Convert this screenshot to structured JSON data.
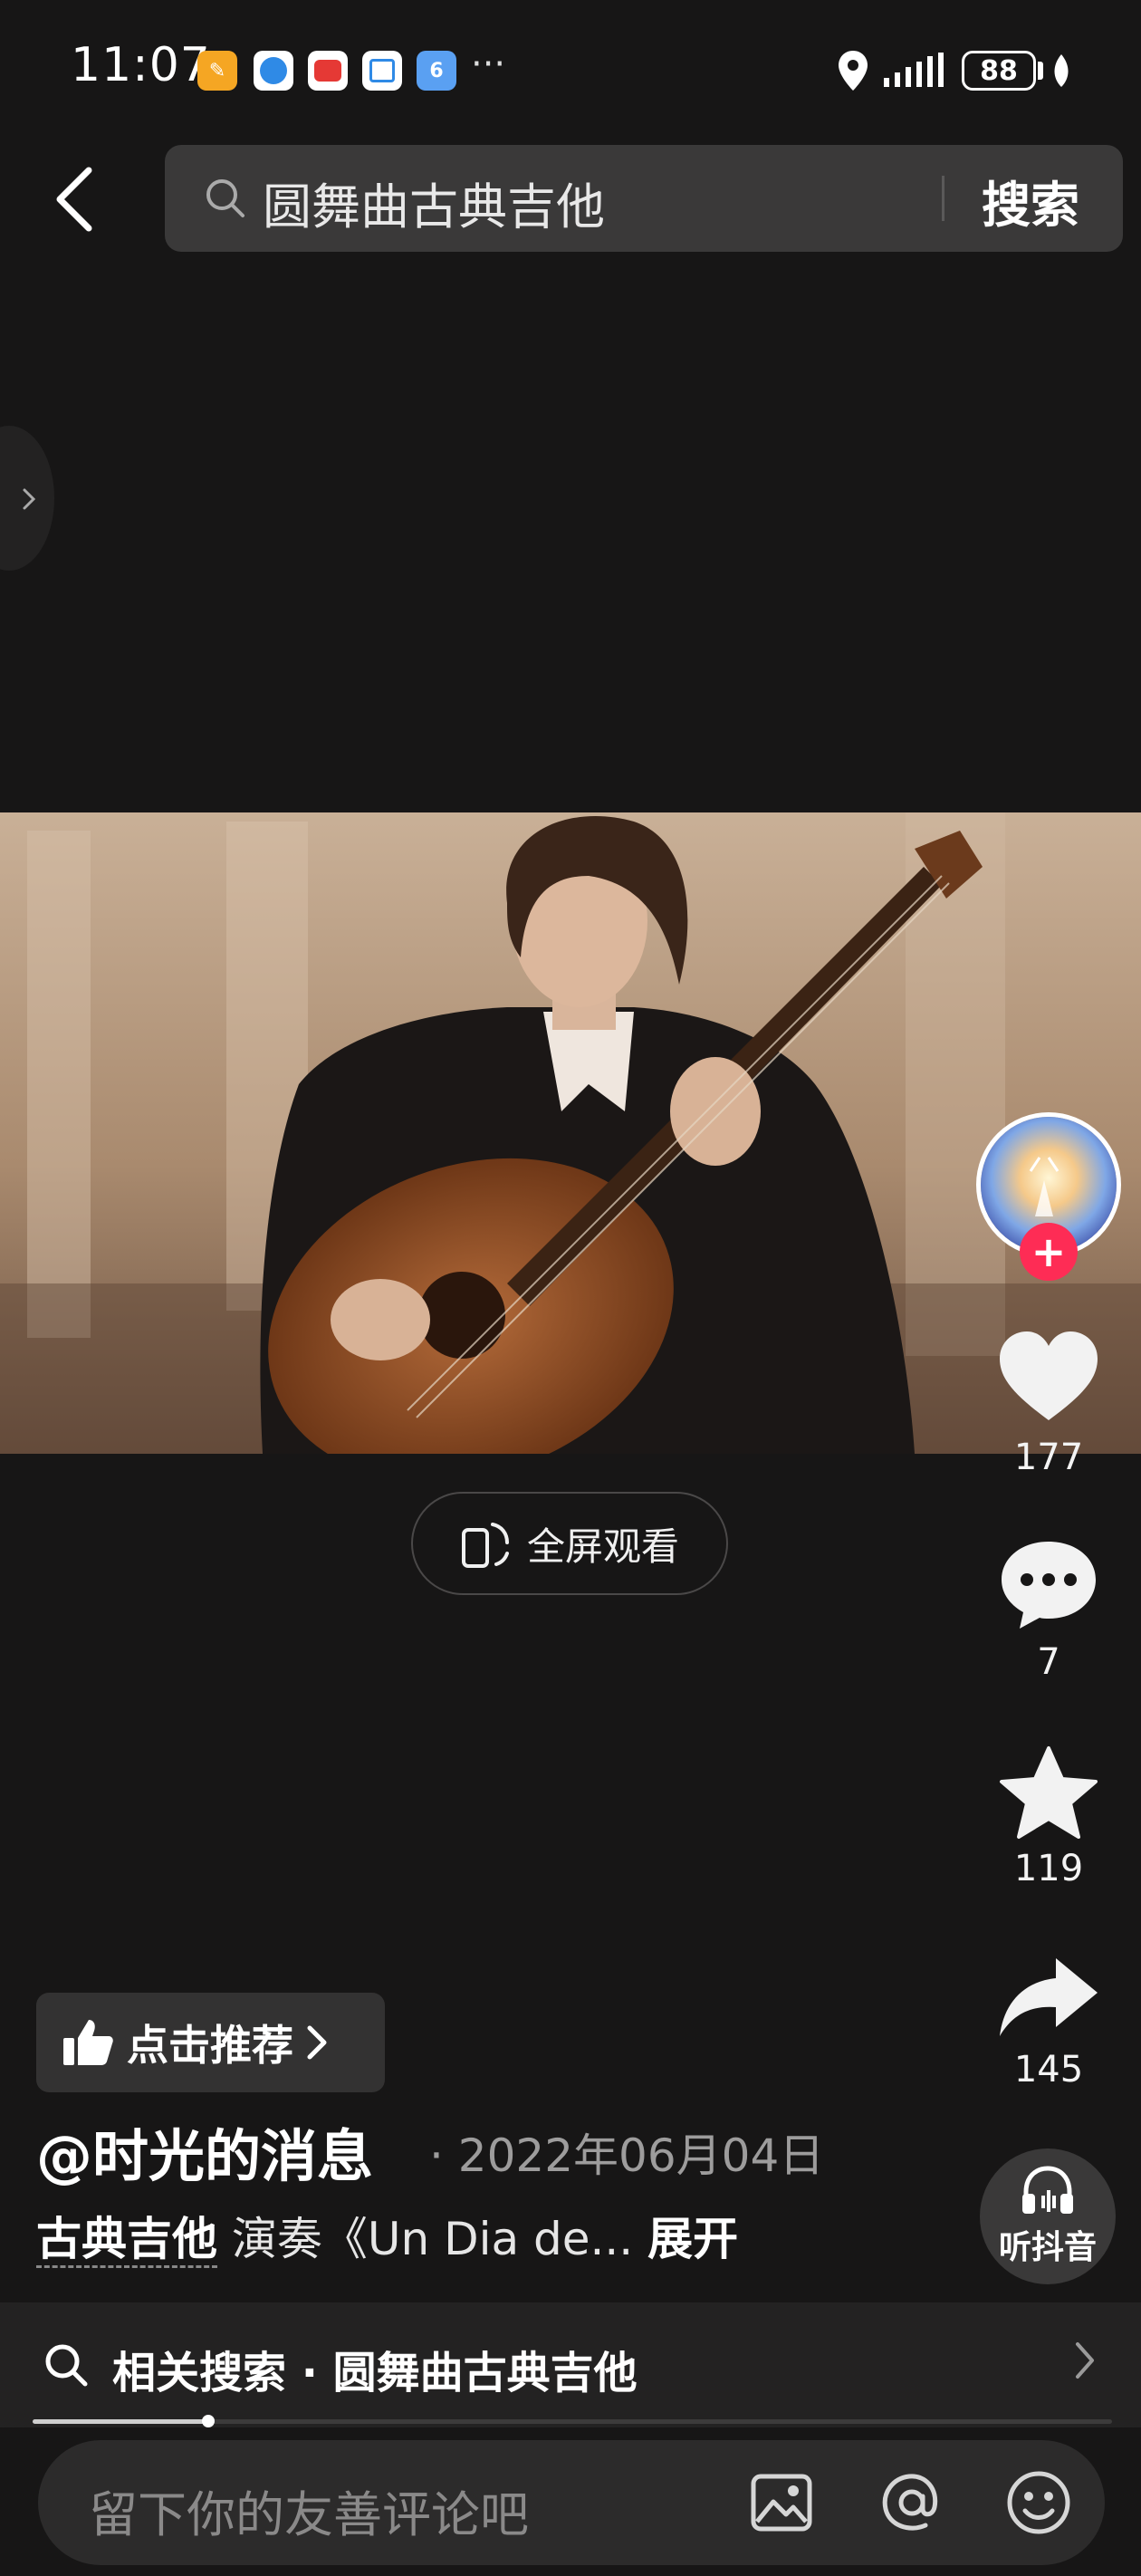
{
  "status_bar": {
    "time": "11:07",
    "more": "···",
    "battery": "88"
  },
  "search": {
    "query": "圆舞曲古典吉他",
    "button_label": "搜索"
  },
  "video": {
    "fullscreen_label": "全屏观看"
  },
  "rail": {
    "likes": "177",
    "comments": "7",
    "favorites": "119",
    "shares": "145"
  },
  "post": {
    "recommend_label": "点击推荐",
    "author": "@时光的消息",
    "date": "· 2022年06月04日",
    "tag": "古典吉他",
    "description": " 演奏《Un Dia de... ",
    "expand_label": "展开"
  },
  "listen": {
    "label": "听抖音"
  },
  "related": {
    "label": "相关搜索 · 圆舞曲古典吉他"
  },
  "comment": {
    "placeholder": "留下你的友善评论吧"
  },
  "colors": {
    "background": "#171616",
    "accent": "#fe2c55"
  }
}
